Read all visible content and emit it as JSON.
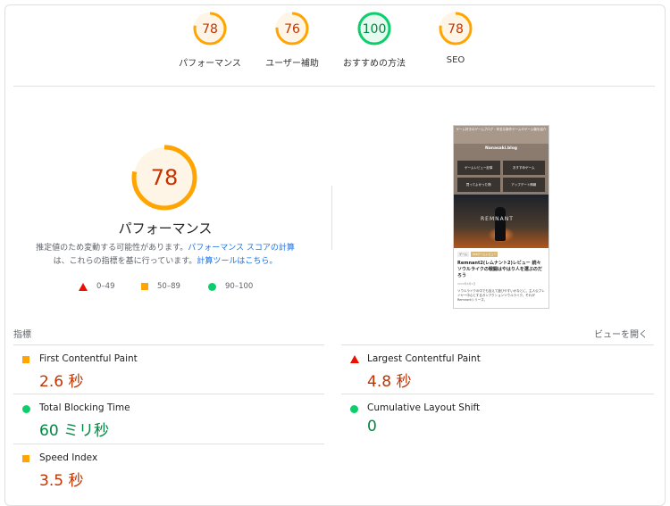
{
  "gauges": [
    {
      "score": "78",
      "label": "パフォーマンス",
      "color": "#ffa400",
      "fill": 0.78
    },
    {
      "score": "76",
      "label": "ユーザー補助",
      "color": "#ffa400",
      "fill": 0.76
    },
    {
      "score": "100",
      "label": "おすすめの方法",
      "color": "#0cce6b",
      "fill": 1.0
    },
    {
      "score": "78",
      "label": "SEO",
      "color": "#ffa400",
      "fill": 0.78
    }
  ],
  "performance": {
    "score": "78",
    "title": "パフォーマンス",
    "desc_1": "推定値のため変動する可能性があります。",
    "desc_link_1": "パフォーマンス スコアの計算",
    "desc_2": "は、これらの指標を基に行っています。",
    "desc_link_2": "計算ツールはこちら。"
  },
  "legend": [
    {
      "label": "0–49",
      "shape": "triangle",
      "color": "#eb0f00"
    },
    {
      "label": "50–89",
      "shape": "square",
      "color": "#ffa400"
    },
    {
      "label": "90–100",
      "shape": "circle",
      "color": "#0cce6b"
    }
  ],
  "phone": {
    "header_text": "ゲーム好きのゲームブログ・有名な新作ゲームやゲーム機を紹介",
    "site_name": "Nanasaki.blog",
    "menu": [
      "ゲームレビュー記事",
      "おすすめゲーム",
      "買ってよかった物",
      "アップデート情報"
    ],
    "hero_logo": "REMNANT",
    "tags": [
      "ゲーム",
      "PS5ゲームレビュー"
    ],
    "title": "Remnant2(レムナント2)レビュー 続々ソウルライクの戦闘はやはり人を選ぶのだろう",
    "meta": "2023年8月1日",
    "text": "ソウルライクの中でも加えて遊びやすいかなとに、主人公プレイヤー中心とするガンアクションソウルライク。それがRemnantシリーズ。"
  },
  "metrics_section": {
    "label": "指標",
    "toggle": "ビューを開く"
  },
  "metrics": [
    {
      "name": "First Contentful Paint",
      "value": "2.6 秒",
      "status": "average"
    },
    {
      "name": "Largest Contentful Paint",
      "value": "4.8 秒",
      "status": "fail"
    },
    {
      "name": "Total Blocking Time",
      "value": "60 ミリ秒",
      "status": "pass"
    },
    {
      "name": "Cumulative Layout Shift",
      "value": "0",
      "status": "pass"
    },
    {
      "name": "Speed Index",
      "value": "3.5 秒",
      "status": "average"
    }
  ]
}
